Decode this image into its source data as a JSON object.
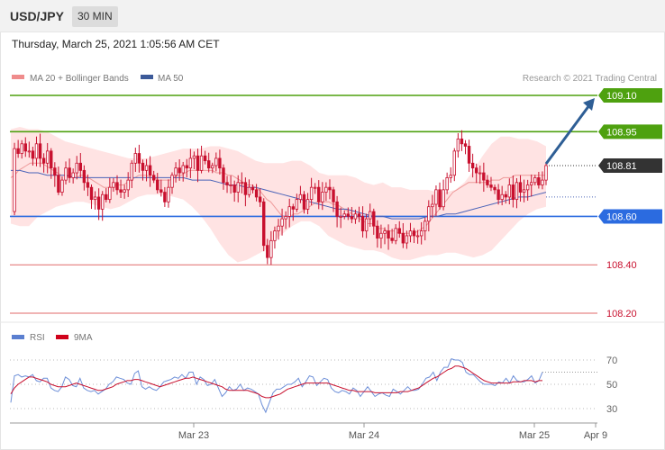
{
  "header": {
    "symbol": "USD/JPY",
    "timeframe": "30 MIN",
    "datetime": "Thursday, March 25, 2021 1:05:56 AM CET"
  },
  "legend": {
    "ma20": "MA 20 + Bollinger Bands",
    "ma50": "MA 50",
    "credit": "Research © 2021 Trading Central",
    "rsi": "RSI",
    "rsi_ma": "9MA"
  },
  "colors": {
    "band_fill": "#ffe3e3",
    "ma20": "#ee9a9a",
    "ma50": "#4a63b8",
    "candle": "#c8102e",
    "resistance": "#4ea10f",
    "support": "#2b6be0",
    "target": "#e06a6a",
    "price": "#333333",
    "arrow": "#2e5e95",
    "rsi": "#6d8fd8",
    "rsi_ma": "#c8102e"
  },
  "chart_data": [
    {
      "type": "candlestick",
      "title": "USD/JPY",
      "ylim": [
        108.2,
        109.15
      ],
      "x_ticks": [
        "Mar 23",
        "Mar 24",
        "Mar 25",
        "Apr 9"
      ],
      "levels": [
        {
          "value": 109.1,
          "label": "109.10",
          "role": "resistance"
        },
        {
          "value": 108.95,
          "label": "108.95",
          "role": "resistance"
        },
        {
          "value": 108.81,
          "label": "108.81",
          "role": "price"
        },
        {
          "value": 108.6,
          "label": "108.60",
          "role": "support"
        },
        {
          "value": 108.4,
          "label": "108.40",
          "role": "target"
        },
        {
          "value": 108.2,
          "label": "108.20",
          "role": "target"
        }
      ],
      "price_path": [
        108.62,
        108.88,
        108.86,
        108.9,
        108.87,
        108.87,
        108.84,
        108.9,
        108.84,
        108.82,
        108.87,
        108.8,
        108.77,
        108.7,
        108.75,
        108.8,
        108.76,
        108.78,
        108.82,
        108.79,
        108.74,
        108.72,
        108.67,
        108.68,
        108.63,
        108.69,
        108.67,
        108.72,
        108.74,
        108.71,
        108.7,
        108.71,
        108.75,
        108.82,
        108.86,
        108.82,
        108.79,
        108.81,
        108.77,
        108.75,
        108.71,
        108.7,
        108.66,
        108.72,
        108.77,
        108.8,
        108.78,
        108.81,
        108.8,
        108.84,
        108.85,
        108.79,
        108.85,
        108.83,
        108.8,
        108.81,
        108.84,
        108.8,
        108.74,
        108.73,
        108.73,
        108.7,
        108.74,
        108.74,
        108.69,
        108.72,
        108.71,
        108.68,
        108.66,
        108.48,
        108.43,
        108.5,
        108.54,
        108.56,
        108.59,
        108.6,
        108.64,
        108.63,
        108.67,
        108.69,
        108.63,
        108.67,
        108.72,
        108.72,
        108.66,
        108.7,
        108.72,
        108.71,
        108.66,
        108.6,
        108.6,
        108.61,
        108.6,
        108.59,
        108.61,
        108.6,
        108.54,
        108.59,
        108.62,
        108.56,
        108.51,
        108.53,
        108.54,
        108.51,
        108.5,
        108.55,
        108.53,
        108.49,
        108.52,
        108.54,
        108.52,
        108.52,
        108.54,
        108.58,
        108.64,
        108.65,
        108.71,
        108.64,
        108.71,
        108.76,
        108.77,
        108.87,
        108.92,
        108.9,
        108.89,
        108.82,
        108.8,
        108.78,
        108.78,
        108.75,
        108.73,
        108.72,
        108.71,
        108.67,
        108.69,
        108.68,
        108.73,
        108.67,
        108.74,
        108.7,
        108.71,
        108.73,
        108.74,
        108.76,
        108.73,
        108.75,
        108.81
      ],
      "ma20_path": [
        108.76,
        108.77,
        108.79,
        108.8,
        108.81,
        108.82,
        108.82,
        108.82,
        108.82,
        108.81,
        108.8,
        108.79,
        108.78,
        108.77,
        108.77,
        108.77,
        108.76,
        108.76,
        108.77,
        108.77,
        108.76,
        108.75,
        108.74,
        108.73,
        108.72,
        108.72,
        108.72,
        108.73,
        108.73,
        108.73,
        108.74,
        108.75,
        108.76,
        108.77,
        108.77,
        108.77,
        108.76,
        108.76,
        108.75,
        108.75,
        108.75,
        108.75,
        108.76,
        108.77,
        108.77,
        108.78,
        108.79,
        108.79,
        108.79,
        108.79,
        108.79,
        108.79,
        108.79,
        108.78,
        108.78,
        108.78,
        108.77,
        108.77,
        108.76,
        108.75,
        108.74,
        108.73,
        108.73,
        108.72,
        108.71,
        108.69,
        108.67,
        108.66,
        108.64,
        108.62,
        108.6,
        108.6,
        108.6,
        108.61,
        108.61,
        108.62,
        108.63,
        108.64,
        108.65,
        108.66,
        108.66,
        108.66,
        108.66,
        108.65,
        108.65,
        108.64,
        108.63,
        108.62,
        108.61,
        108.6,
        108.59,
        108.58,
        108.57,
        108.57,
        108.56,
        108.55,
        108.55,
        108.54,
        108.54,
        108.54,
        108.53,
        108.53,
        108.53,
        108.53,
        108.53,
        108.54,
        108.55,
        108.56,
        108.58,
        108.6,
        108.62,
        108.64,
        108.66,
        108.68,
        108.7,
        108.71,
        108.72,
        108.73,
        108.74,
        108.74,
        108.74,
        108.74,
        108.74,
        108.74,
        108.75,
        108.75,
        108.75,
        108.76,
        108.76,
        108.76,
        108.77,
        108.77,
        108.77,
        108.77,
        108.77,
        108.77,
        108.77,
        108.77,
        108.77
      ],
      "ma50_path": [
        108.79,
        108.79,
        108.78,
        108.78,
        108.77,
        108.77,
        108.77,
        108.76,
        108.76,
        108.76,
        108.76,
        108.76,
        108.76,
        108.76,
        108.76,
        108.76,
        108.76,
        108.76,
        108.76,
        108.76,
        108.75,
        108.75,
        108.75,
        108.74,
        108.73,
        108.73,
        108.72,
        108.72,
        108.71,
        108.7,
        108.69,
        108.68,
        108.67,
        108.66,
        108.65,
        108.64,
        108.63,
        108.63,
        108.62,
        108.61,
        108.6,
        108.6,
        108.59,
        108.59,
        108.59,
        108.59,
        108.6,
        108.6,
        108.61,
        108.61,
        108.62,
        108.63,
        108.64,
        108.65,
        108.66,
        108.67,
        108.68,
        108.68,
        108.69,
        108.7
      ],
      "upper_band_path": [
        108.96,
        108.97,
        108.96,
        108.96,
        108.95,
        108.93,
        108.91,
        108.9,
        108.89,
        108.88,
        108.87,
        108.86,
        108.85,
        108.84,
        108.84,
        108.84,
        108.85,
        108.86,
        108.87,
        108.88,
        108.88,
        108.88,
        108.89,
        108.89,
        108.88,
        108.87,
        108.85,
        108.83,
        108.82,
        108.82,
        108.82,
        108.83,
        108.83,
        108.81,
        108.78,
        108.77,
        108.77,
        108.77,
        108.76,
        108.74,
        108.73,
        108.74,
        108.72,
        108.72,
        108.71,
        108.71,
        108.71,
        108.7,
        108.7,
        108.71,
        108.74,
        108.79,
        108.85,
        108.9,
        108.93,
        108.93,
        108.92,
        108.92,
        108.91,
        108.89
      ],
      "lower_band_path": [
        108.57,
        108.56,
        108.56,
        108.6,
        108.62,
        108.64,
        108.65,
        108.66,
        108.66,
        108.65,
        108.64,
        108.63,
        108.64,
        108.66,
        108.68,
        108.69,
        108.69,
        108.69,
        108.68,
        108.67,
        108.64,
        108.6,
        108.55,
        108.49,
        108.44,
        108.41,
        108.42,
        108.44,
        108.46,
        108.5,
        108.53,
        108.56,
        108.58,
        108.58,
        108.56,
        108.52,
        108.5,
        108.48,
        108.47,
        108.46,
        108.46,
        108.45,
        108.43,
        108.42,
        108.42,
        108.43,
        108.44,
        108.44,
        108.45,
        108.45,
        108.44,
        108.43,
        108.44,
        108.46,
        108.5,
        108.54,
        108.58,
        108.61,
        108.63,
        108.64
      ],
      "projection": {
        "from": 108.81,
        "to": 109.1,
        "label": "109.10"
      }
    },
    {
      "type": "line",
      "title": "RSI",
      "ylim": [
        20,
        80
      ],
      "y_ticks": [
        70,
        50,
        30
      ],
      "series": [
        {
          "name": "RSI",
          "values": [
            35,
            57,
            58,
            56,
            57,
            56,
            58,
            53,
            52,
            55,
            55,
            47,
            45,
            44,
            48,
            56,
            54,
            49,
            48,
            55,
            47,
            45,
            44,
            45,
            42,
            44,
            46,
            50,
            52,
            56,
            55,
            54,
            51,
            50,
            59,
            61,
            48,
            46,
            48,
            46,
            45,
            48,
            52,
            53,
            54,
            56,
            55,
            58,
            55,
            60,
            60,
            50,
            56,
            54,
            49,
            50,
            54,
            47,
            40,
            43,
            48,
            45,
            46,
            50,
            45,
            47,
            46,
            44,
            42,
            33,
            27,
            35,
            43,
            46,
            46,
            48,
            50,
            50,
            52,
            55,
            48,
            52,
            57,
            56,
            49,
            52,
            55,
            54,
            47,
            44,
            43,
            45,
            44,
            42,
            47,
            45,
            40,
            44,
            48,
            44,
            40,
            42,
            43,
            41,
            40,
            46,
            44,
            42,
            45,
            48,
            45,
            45,
            46,
            50,
            55,
            56,
            60,
            53,
            60,
            64,
            64,
            71,
            70,
            70,
            68,
            60,
            58,
            58,
            55,
            52,
            50,
            50,
            50,
            49,
            52,
            51,
            55,
            51,
            57,
            53,
            52,
            52,
            54,
            57,
            51,
            53,
            60
          ]
        },
        {
          "name": "9MA",
          "values": [
            42,
            47,
            50,
            52,
            54,
            56,
            56,
            55,
            54,
            53,
            52,
            50,
            49,
            48,
            48,
            48,
            49,
            50,
            51,
            50,
            49,
            48,
            47,
            46,
            45,
            45,
            46,
            47,
            48,
            50,
            51,
            52,
            53,
            53,
            54,
            54,
            53,
            52,
            51,
            50,
            49,
            48,
            49,
            50,
            51,
            52,
            53,
            54,
            55,
            55,
            56,
            55,
            54,
            53,
            52,
            51,
            50,
            49,
            48,
            46,
            45,
            45,
            45,
            45,
            45,
            45,
            44,
            43,
            42,
            40,
            39,
            39,
            40,
            41,
            42,
            44,
            46,
            47,
            48,
            49,
            50,
            51,
            51,
            51,
            51,
            51,
            51,
            51,
            50,
            49,
            48,
            47,
            46,
            45,
            45,
            44,
            44,
            44,
            44,
            44,
            43,
            43,
            43,
            43,
            43,
            43,
            43,
            44,
            44,
            44,
            45,
            46,
            47,
            49,
            51,
            53,
            55,
            56,
            58,
            60,
            62,
            63,
            65,
            65,
            64,
            63,
            61,
            59,
            57,
            55,
            53,
            52,
            51,
            51,
            51,
            51,
            51,
            51,
            52,
            52,
            52,
            53,
            53,
            53,
            52,
            53,
            53
          ]
        }
      ]
    }
  ]
}
